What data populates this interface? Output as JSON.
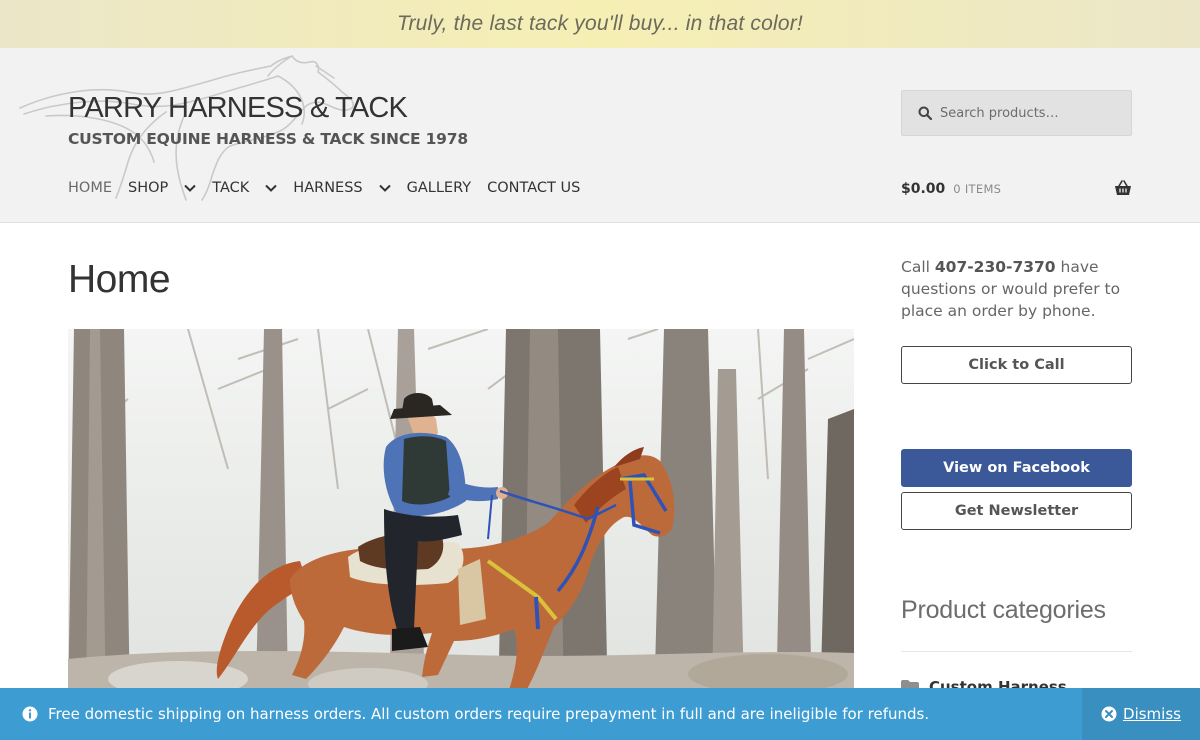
{
  "topbar": {
    "tagline": "Truly, the last tack you'll buy... in that color!"
  },
  "header": {
    "site_title": "PARRY HARNESS & TACK",
    "site_tagline": "CUSTOM EQUINE HARNESS & TACK SINCE 1978",
    "logo_icon": "horse-silhouette-logo",
    "nav": [
      {
        "label": "HOME",
        "active": true,
        "has_submenu": false
      },
      {
        "label": "SHOP",
        "active": false,
        "has_submenu": true
      },
      {
        "label": "TACK",
        "active": false,
        "has_submenu": true
      },
      {
        "label": "HARNESS",
        "active": false,
        "has_submenu": true
      },
      {
        "label": "GALLERY",
        "active": false,
        "has_submenu": false
      },
      {
        "label": "CONTACT US",
        "active": false,
        "has_submenu": false
      }
    ],
    "search": {
      "placeholder": "Search products…",
      "icon": "search-icon"
    },
    "cart": {
      "amount": "$0.00",
      "count": "0 ITEMS",
      "icon": "basket-icon"
    }
  },
  "main": {
    "page_title": "Home",
    "hero_image": "rider-on-chestnut-horse-in-woods-photo"
  },
  "sidebar": {
    "call_prefix": "Call ",
    "phone": "407-230-7370",
    "call_suffix": " have questions or would prefer to place an order by phone.",
    "click_to_call": "Click to Call",
    "facebook": "View on Facebook",
    "newsletter": "Get Newsletter",
    "categories_title": "Product categories",
    "categories": [
      {
        "label": "Custom Harness",
        "icon": "folder-icon"
      }
    ]
  },
  "notice": {
    "text": "Free domestic shipping on harness orders. All custom orders require prepayment in full and are ineligible for refunds.",
    "dismiss": "Dismiss",
    "info_icon": "info-icon",
    "close_icon": "close-circle-icon"
  },
  "colors": {
    "topbar_bg": "#f6efb4",
    "header_bg": "#f2f2f2",
    "facebook_blue": "#3b5998",
    "notice_blue": "#3d9cd2"
  }
}
